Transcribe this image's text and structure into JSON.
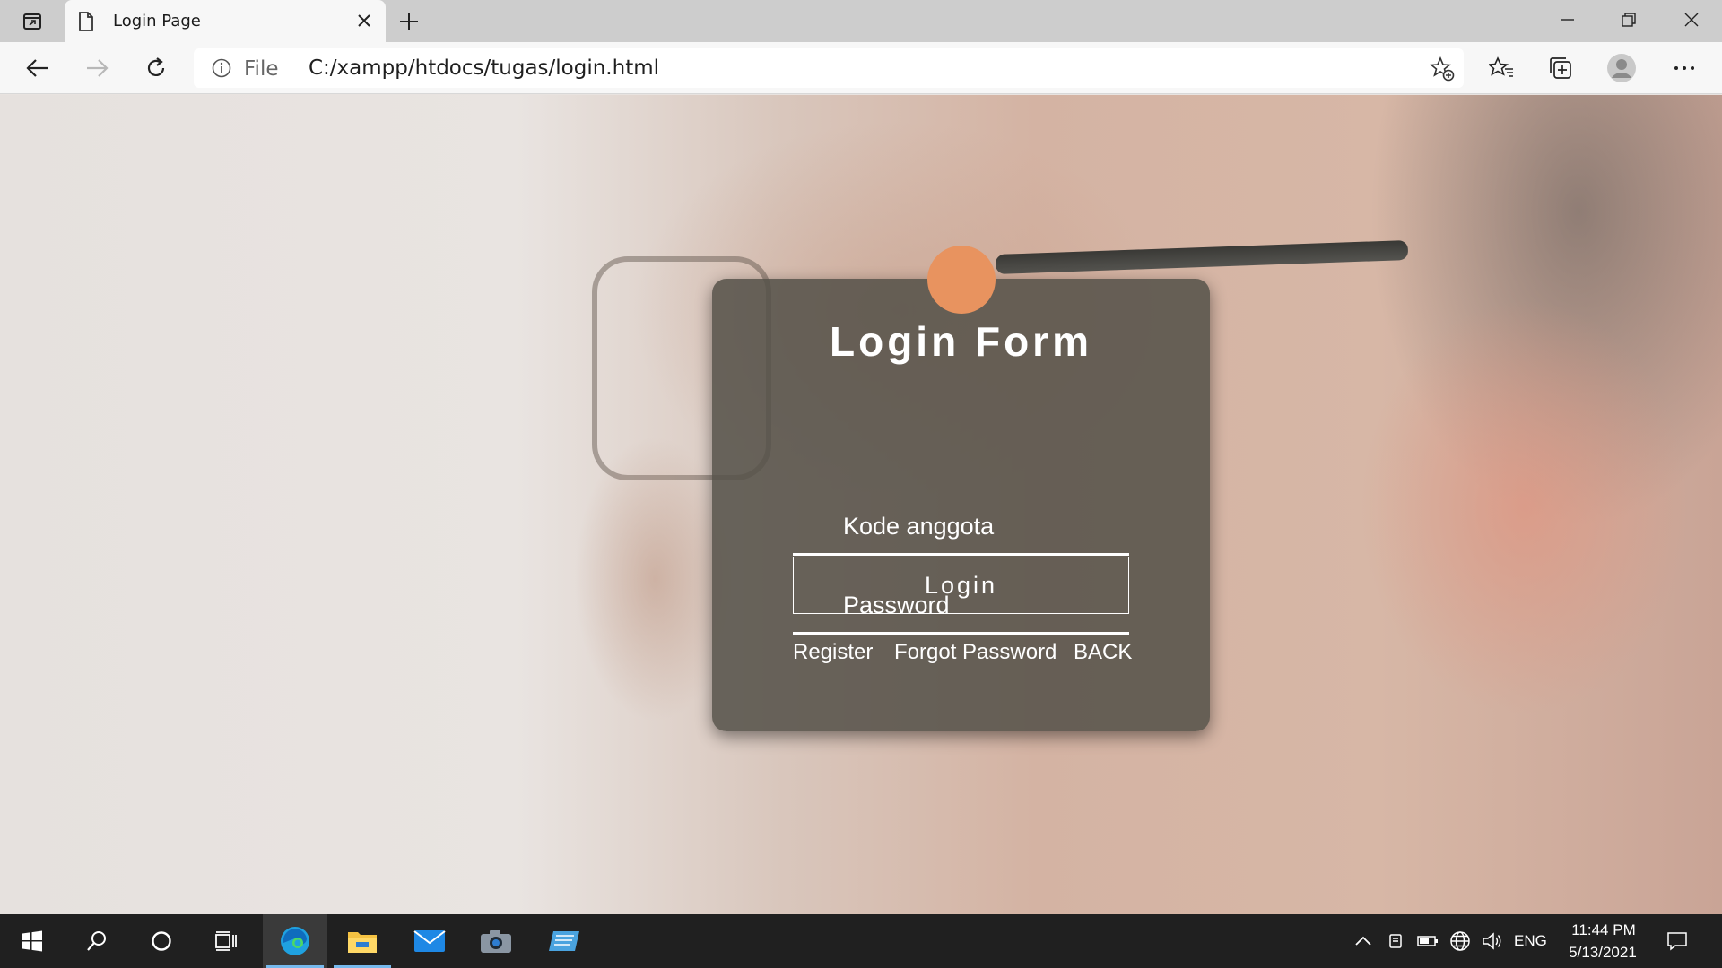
{
  "browser": {
    "tab_title": "Login Page",
    "address_scheme": "File",
    "address_url": "C:/xampp/htdocs/tugas/login.html"
  },
  "login_form": {
    "title": "Login Form",
    "username_label": "Kode anggota",
    "password_label": "Password",
    "login_button": "Login",
    "links": [
      "Register",
      "Forgot Password",
      "BACK"
    ]
  },
  "taskbar": {
    "language": "ENG",
    "time": "11:44 PM",
    "date": "5/13/2021"
  },
  "colors": {
    "avatar_circle": "#e8935f",
    "card_background": "#545048",
    "taskbar": "#202020",
    "tab_strip": "#cdcdcd"
  }
}
